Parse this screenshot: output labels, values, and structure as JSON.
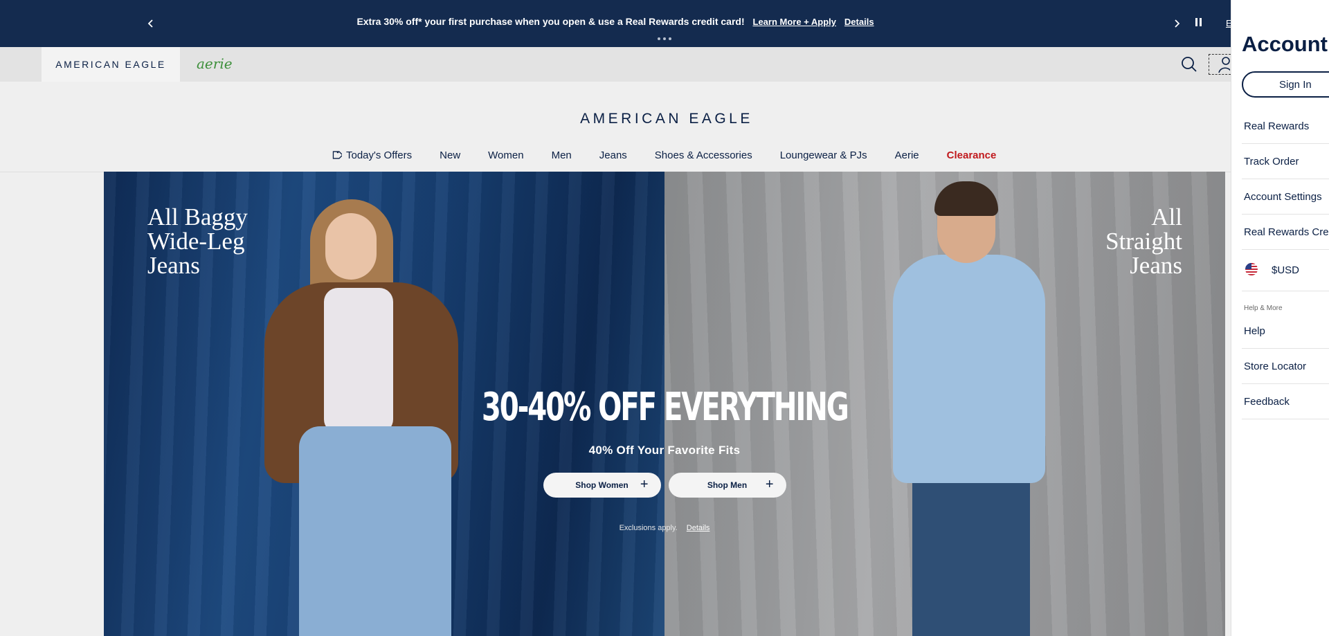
{
  "promo": {
    "message": "Extra 30% off* your first purchase when you open & use a Real Rewards credit card!",
    "link1": "Learn More + Apply",
    "link2": "Details",
    "edge_text": "E"
  },
  "brandbar": {
    "ae_label": "AMERICAN EAGLE",
    "aerie_label": "aerie"
  },
  "logo": "AMERICAN EAGLE",
  "nav": {
    "items": [
      "Today's Offers",
      "New",
      "Women",
      "Men",
      "Jeans",
      "Shoes & Accessories",
      "Loungewear & PJs",
      "Aerie",
      "Clearance"
    ]
  },
  "hero": {
    "left_title": [
      "All Baggy",
      "Wide-Leg",
      "Jeans"
    ],
    "right_title": [
      "All",
      "Straight",
      "Jeans"
    ],
    "headline": "30-40% OFF EVERYTHING",
    "subheadline": "40% Off Your Favorite Fits",
    "btn_women": "Shop Women",
    "btn_men": "Shop Men",
    "fine_print": "Exclusions apply.",
    "fine_link": "Details"
  },
  "account_panel": {
    "title": "Account",
    "sign_in": "Sign In",
    "links": [
      "Real Rewards",
      "Track Order",
      "Account Settings",
      "Real Rewards Cred"
    ],
    "currency": "$USD",
    "help_heading": "Help & More",
    "help_links": [
      "Help",
      "Store Locator",
      "Feedback"
    ]
  },
  "colors": {
    "navy": "#142b4f",
    "clearance_red": "#c0191d",
    "aerie_green": "#3c8f3a"
  }
}
